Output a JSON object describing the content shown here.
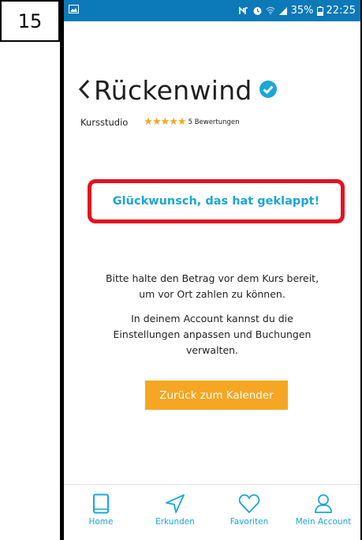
{
  "step": {
    "number": "15"
  },
  "status_bar": {
    "battery": "35%",
    "time": "22:25"
  },
  "header": {
    "back_icon": "chevron-left-icon",
    "title": "Rückenwind",
    "verified_icon": "verified-check-icon",
    "category": "Kursstudio",
    "rating_stars": "★★★★★",
    "rating": 5,
    "reviews": "5 Bewertungen"
  },
  "confirmation": {
    "headline": "Glückwunsch, das hat geklappt!",
    "message_1_line_1": "Bitte halte den Betrag vor dem Kurs bereit,",
    "message_1_line_2": "um vor Ort zahlen zu können.",
    "message_2_line_1": "In deinem Account kannst du die",
    "message_2_line_2": "Einstellungen anpassen und Buchungen",
    "message_2_line_3": "verwalten.",
    "button_label": "Zurück zum Kalender"
  },
  "nav": {
    "items": [
      {
        "label": "Home",
        "icon": "tablet-icon"
      },
      {
        "label": "Erkunden",
        "icon": "navigation-arrow-icon"
      },
      {
        "label": "Favoriten",
        "icon": "heart-icon"
      },
      {
        "label": "Mein Account",
        "icon": "user-icon"
      }
    ]
  },
  "colors": {
    "status_bar": "#0c79b8",
    "accent": "#1aa6d8",
    "button": "#f5a623",
    "highlight_border": "#e6101e",
    "stars": "#f6a623"
  }
}
